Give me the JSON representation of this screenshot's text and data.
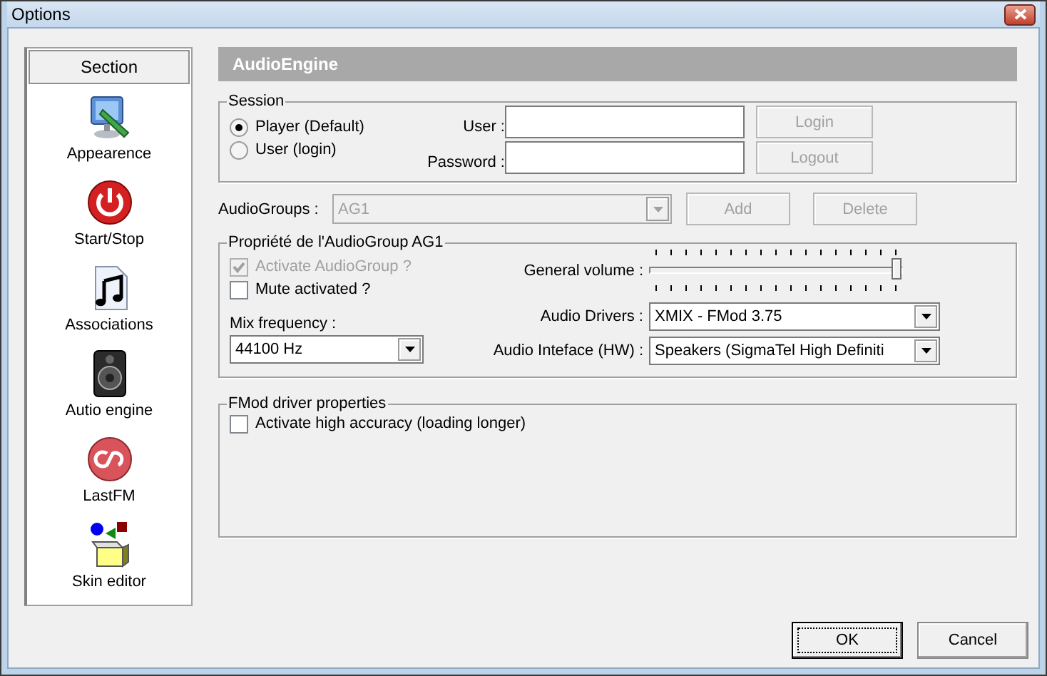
{
  "window": {
    "title": "Options"
  },
  "sidebar": {
    "header": "Section",
    "items": [
      {
        "label": "Appearence"
      },
      {
        "label": "Start/Stop"
      },
      {
        "label": "Associations"
      },
      {
        "label": "Autio engine"
      },
      {
        "label": "LastFM"
      },
      {
        "label": "Skin editor"
      }
    ]
  },
  "panel": {
    "title": "AudioEngine"
  },
  "session": {
    "legend": "Session",
    "radios": [
      {
        "label": "Player (Default)",
        "selected": true
      },
      {
        "label": "User (login)",
        "selected": false
      }
    ],
    "fields": [
      {
        "label": "User :"
      },
      {
        "label": "Password :"
      }
    ],
    "buttons": [
      {
        "label": "Login",
        "disabled": true
      },
      {
        "label": "Logout",
        "disabled": true
      }
    ]
  },
  "audiogroups": {
    "label": "AudioGroups :",
    "value": "AG1",
    "disabled": true,
    "buttons": [
      {
        "label": "Add",
        "disabled": true
      },
      {
        "label": "Delete",
        "disabled": true
      }
    ]
  },
  "group_properties": {
    "legend": "Propriété de l'AudioGroup AG1",
    "checkboxes": [
      {
        "label": "Activate AudioGroup ?",
        "checked": true,
        "disabled": true
      },
      {
        "label": "Mute activated ?",
        "checked": false,
        "disabled": false
      }
    ],
    "mix_frequency": {
      "label": "Mix frequency :",
      "value": "44100 Hz"
    },
    "volume": {
      "label": "General volume :",
      "level": 1
    },
    "drivers": {
      "label": "Audio Drivers :",
      "value": "XMIX - FMod 3.75"
    },
    "interface": {
      "label": "Audio Inteface (HW) :",
      "value": "Speakers (SigmaTel High Definiti"
    }
  },
  "fmod": {
    "legend": "FMod driver properties",
    "checkboxes": [
      {
        "label": "Activate high accuracy (loading longer)",
        "checked": false,
        "disabled": false
      }
    ]
  },
  "buttons": [
    {
      "label": "OK",
      "default": true
    },
    {
      "label": "Cancel",
      "default": false
    }
  ]
}
